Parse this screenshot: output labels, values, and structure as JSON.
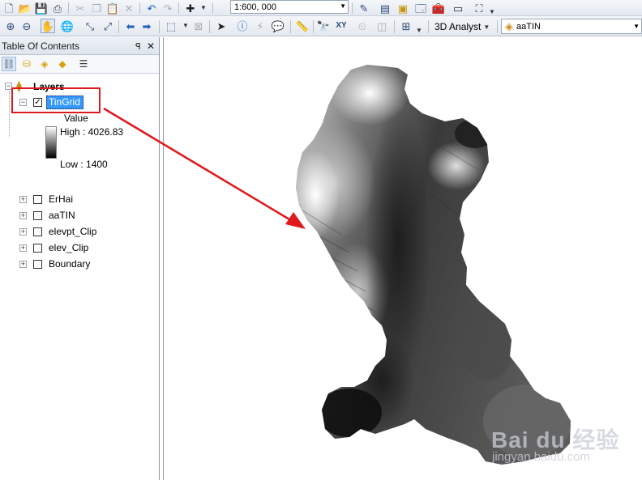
{
  "toolbar_standard": {
    "scale": "1:600, 000",
    "icons": [
      "new-document-icon",
      "open-folder-icon",
      "save-icon",
      "print-icon",
      "cut-icon",
      "copy-icon",
      "paste-icon",
      "delete-icon",
      "undo-icon",
      "redo-icon",
      "add-data-icon",
      "editor-toolbar-icon",
      "table-icon",
      "catalog-icon",
      "search-window-icon",
      "arctoolbox-icon",
      "python-icon",
      "model-builder-icon"
    ]
  },
  "toolbar_tools": {
    "icons": [
      "zoom-in-icon",
      "zoom-out-icon",
      "pan-icon",
      "full-extent-icon",
      "fixed-zoom-in-icon",
      "fixed-zoom-out-icon",
      "back-extent-icon",
      "forward-extent-icon",
      "select-features-icon",
      "clear-selection-icon",
      "select-elements-icon",
      "identify-icon",
      "hyperlink-icon",
      "html-popup-icon",
      "measure-icon",
      "find-icon",
      "go-to-xy-icon",
      "time-slider-icon",
      "create-viewer-window-icon"
    ],
    "analyst_label": "3D Analyst",
    "layer_combo": "aaTIN"
  },
  "toc": {
    "title": "Table Of Contents",
    "root": "Layers",
    "selected_layer": "TinGrid",
    "legend": {
      "field": "Value",
      "high": "High : 4026.83",
      "low": "Low : 1400"
    },
    "layers": [
      {
        "name": "ErHai",
        "checked": false
      },
      {
        "name": "aaTIN",
        "checked": false
      },
      {
        "name": "elevpt_Clip",
        "checked": false
      },
      {
        "name": "elev_Clip",
        "checked": false
      },
      {
        "name": "Boundary",
        "checked": false
      }
    ]
  },
  "watermark": {
    "logo": "Bai du 经验",
    "url": "jingyan.baidu.com"
  },
  "colors": {
    "annotation": "#e0191d",
    "selection": "#3399ff",
    "raster_high": "#ffffff",
    "raster_low": "#000000"
  }
}
